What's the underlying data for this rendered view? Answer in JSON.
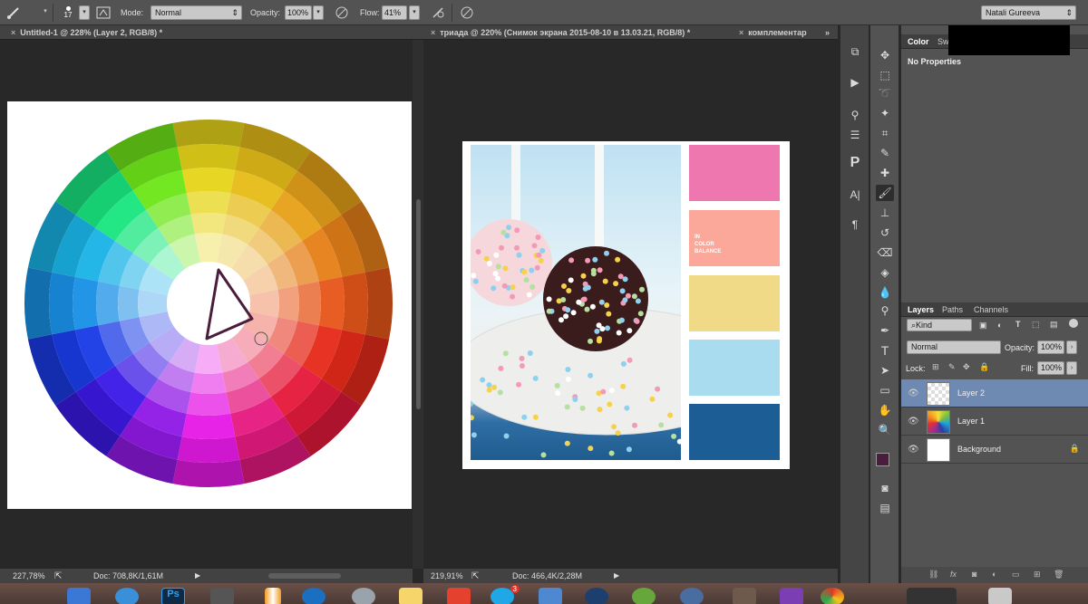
{
  "options_bar": {
    "brush_size": "17",
    "mode_label": "Mode:",
    "mode_value": "Normal",
    "opacity_label": "Opacity:",
    "opacity_value": "100%",
    "flow_label": "Flow:",
    "flow_value": "41%",
    "workspace": "Natali Gureeva"
  },
  "tabs": [
    {
      "label": "Untitled-1 @ 228% (Layer 2, RGB/8) *"
    },
    {
      "label": "триада @ 220% (Снимок экрана 2015-08-10 в 13.03.21, RGB/8) *"
    },
    {
      "label": "комплементар"
    }
  ],
  "status_left": {
    "zoom": "227,78%",
    "doc": "Doc: 708,8K/1,61M"
  },
  "status_right": {
    "zoom": "219,91%",
    "doc": "Doc: 466,4K/2,28M"
  },
  "palette_text": "IN\nCOLOR\nBALANCE",
  "swatches": [
    "#ef77b0",
    "#fba89a",
    "#f0da88",
    "#a9dcef",
    "#1b5d94"
  ],
  "color_panel": {
    "tabs": [
      "Color",
      "Sw"
    ],
    "content": "No Properties"
  },
  "layers_panel": {
    "tabs": [
      "Layers",
      "Paths",
      "Channels"
    ],
    "kind": "Kind",
    "blend_mode": "Normal",
    "opacity_label": "Opacity:",
    "opacity_value": "100%",
    "lock_label": "Lock:",
    "fill_label": "Fill:",
    "fill_value": "100%",
    "layers": [
      {
        "name": "Layer 2",
        "selected": true
      },
      {
        "name": "Layer 1",
        "selected": false
      },
      {
        "name": "Background",
        "selected": false
      }
    ]
  },
  "dock": {
    "badge": "3"
  },
  "colors": {
    "foreground": "#4a1d3c",
    "background": "#ffffff",
    "selection": "#6f8ab2"
  }
}
